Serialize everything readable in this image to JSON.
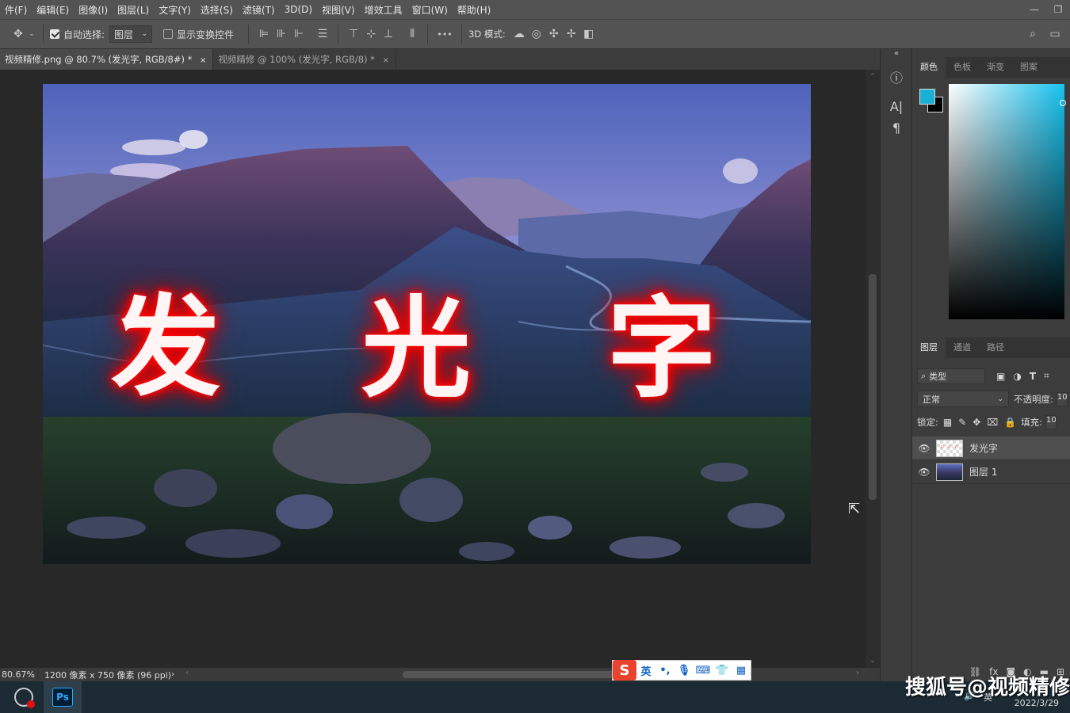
{
  "menu": [
    "件(F)",
    "编辑(E)",
    "图像(I)",
    "图层(L)",
    "文字(Y)",
    "选择(S)",
    "滤镜(T)",
    "3D(D)",
    "视图(V)",
    "增效工具",
    "窗口(W)",
    "帮助(H)"
  ],
  "options": {
    "auto_select_label": "自动选择:",
    "auto_select_value": "图层",
    "show_transform_label": "显示变换控件",
    "mode_3d_label": "3D 模式:",
    "more": "•••"
  },
  "tabs": [
    {
      "label": "视频精修.png @ 80.7% (发光字, RGB/8#) *",
      "close": "×"
    },
    {
      "label": "视频精修 @ 100% (发光字, RGB/8) *",
      "close": "×"
    }
  ],
  "canvas_text": {
    "char1": "发",
    "char2": "光",
    "char3": "字"
  },
  "status": {
    "zoom": "80.67%",
    "doc_info": "1200 像素 x 750 像素 (96 ppi)"
  },
  "panels": {
    "color_tabs": [
      "颜色",
      "色板",
      "渐变",
      "图案"
    ],
    "layer_tabs": [
      "图层",
      "通道",
      "路径"
    ],
    "filter_label": "类型",
    "blend_mode": "正常",
    "opacity_label": "不透明度:",
    "opacity_value": "10",
    "lock_label": "锁定:",
    "fill_label": "填充:",
    "fill_value": "10",
    "layers": [
      {
        "name": "发光字",
        "selected": true
      },
      {
        "name": "图层 1",
        "selected": false
      }
    ],
    "fg_color": "#1ab0d4",
    "bg_color": "#000000"
  },
  "ime": {
    "mode": "英",
    "punct": "•,"
  },
  "taskbar": {
    "ps_label": "Ps",
    "date": "2022/3/29",
    "tray_lang": "英"
  },
  "watermark": "搜狐号@视频精修"
}
